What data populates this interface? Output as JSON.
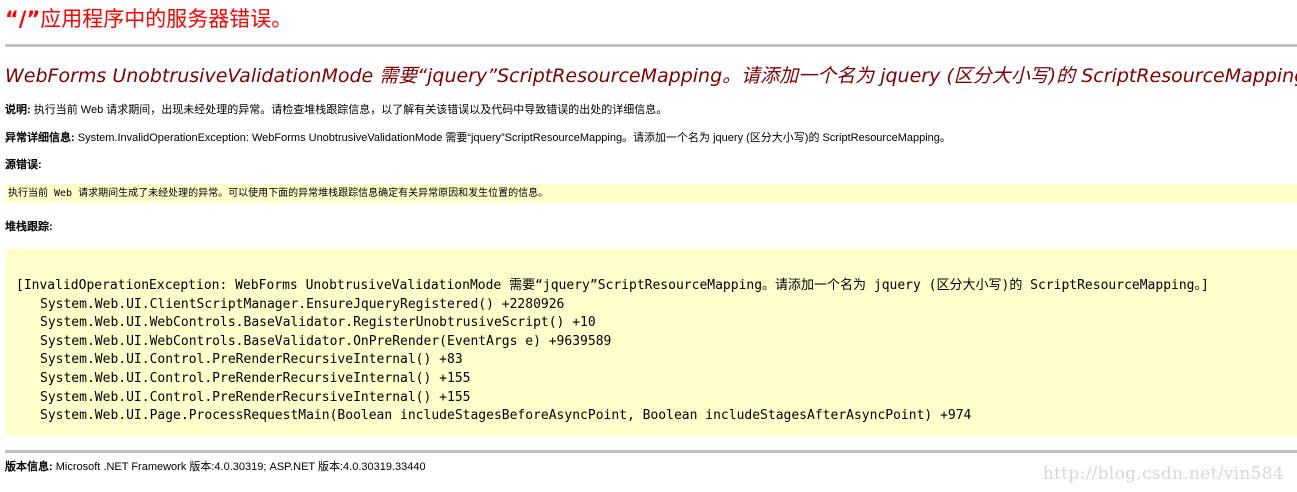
{
  "header": {
    "app_path": "“/”",
    "server_error": "应用程序中的服务器错误。"
  },
  "error": {
    "title": "WebForms UnobtrusiveValidationMode 需要“jquery”ScriptResourceMapping。请添加一个名为 jquery (区分大小写)的 ScriptResourceMapping。"
  },
  "description": {
    "label": "说明:",
    "text": " 执行当前 Web 请求期间，出现未经处理的异常。请检查堆栈跟踪信息，以了解有关该错误以及代码中导致错误的出处的详细信息。"
  },
  "exception_details": {
    "label": "异常详细信息:",
    "text": " System.InvalidOperationException: WebForms UnobtrusiveValidationMode 需要“jquery”ScriptResourceMapping。请添加一个名为 jquery (区分大小写)的 ScriptResourceMapping。"
  },
  "source_error": {
    "label": "源错误:",
    "text": "执行当前 Web 请求期间生成了未经处理的异常。可以使用下面的异常堆栈跟踪信息确定有关异常原因和发生位置的信息。"
  },
  "stack_trace": {
    "label": "堆栈跟踪:",
    "lines": [
      "[InvalidOperationException: WebForms UnobtrusiveValidationMode 需要“jquery”ScriptResourceMapping。请添加一个名为 jquery (区分大小写)的 ScriptResourceMapping。]",
      "System.Web.UI.ClientScriptManager.EnsureJqueryRegistered() +2280926",
      "System.Web.UI.WebControls.BaseValidator.RegisterUnobtrusiveScript() +10",
      "System.Web.UI.WebControls.BaseValidator.OnPreRender(EventArgs e) +9639589",
      "System.Web.UI.Control.PreRenderRecursiveInternal() +83",
      "System.Web.UI.Control.PreRenderRecursiveInternal() +155",
      "System.Web.UI.Control.PreRenderRecursiveInternal() +155",
      "System.Web.UI.Page.ProcessRequestMain(Boolean includeStagesBeforeAsyncPoint, Boolean includeStagesAfterAsyncPoint) +974"
    ]
  },
  "version": {
    "label": "版本信息:",
    "text": " Microsoft .NET Framework 版本:4.0.30319; ASP.NET 版本:4.0.30319.33440"
  },
  "watermark": "http://blog.csdn.net/vin584"
}
